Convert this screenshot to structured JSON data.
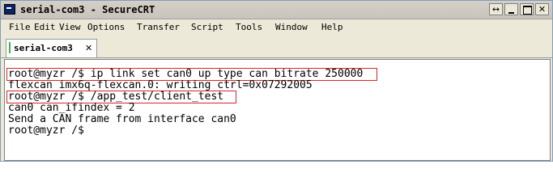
{
  "window": {
    "title": "serial-com3 - SecureCRT"
  },
  "menubar": {
    "items": [
      "File",
      "Edit",
      "View",
      "Options",
      "Transfer",
      "Script",
      "Tools",
      "Window",
      "Help"
    ]
  },
  "tabs": [
    {
      "label": "serial-com3"
    }
  ],
  "terminal": {
    "lines": [
      "root@myzr /$ ip link set can0 up type can bitrate 250000",
      "flexcan imx6q-flexcan.0: writing ctrl=0x07292005",
      "root@myzr /$ /app_test/client_test",
      "can0 can_ifindex = 2",
      "Send a CAN frame from interface can0",
      "root@myzr /$"
    ]
  },
  "colors": {
    "highlight_box": "#d9262a",
    "tab_indicator": "#3cb44b"
  }
}
